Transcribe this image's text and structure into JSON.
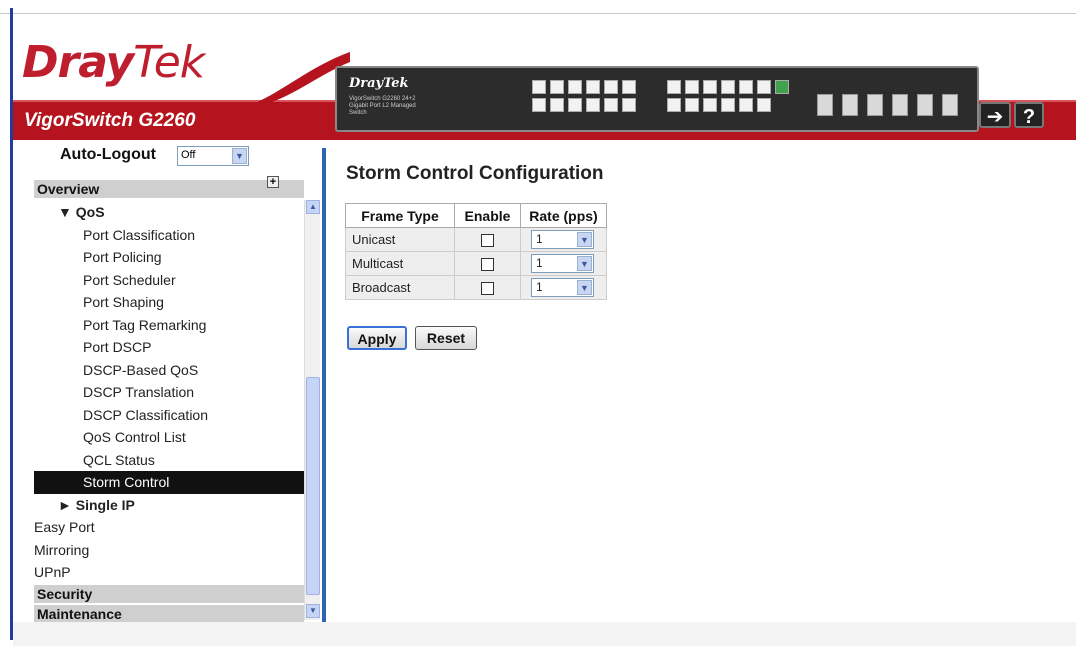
{
  "brand": {
    "logo_dray": "Dray",
    "logo_tek": "Tek",
    "model": "VigorSwitch G2260",
    "device_brand": "DrayTek",
    "device_sub": "VigorSwitch G2260 24+2 Gigabit Port L2 Managed Switch",
    "accent": "#be1e2d",
    "band_color": "#b5141f"
  },
  "header": {
    "logout_icon": "logout-icon",
    "help_label": "?"
  },
  "autologout": {
    "label": "Auto-Logout",
    "value": "Off"
  },
  "sidebar": {
    "section_overview": "Overview",
    "items": [
      {
        "label": "▼ QoS",
        "level": 1
      },
      {
        "label": "Port Classification",
        "level": 2
      },
      {
        "label": "Port Policing",
        "level": 2
      },
      {
        "label": "Port Scheduler",
        "level": 2
      },
      {
        "label": "Port Shaping",
        "level": 2
      },
      {
        "label": "Port Tag Remarking",
        "level": 2
      },
      {
        "label": "Port DSCP",
        "level": 2
      },
      {
        "label": "DSCP-Based QoS",
        "level": 2
      },
      {
        "label": "DSCP Translation",
        "level": 2
      },
      {
        "label": "DSCP Classification",
        "level": 2
      },
      {
        "label": "QoS Control List",
        "level": 2
      },
      {
        "label": "QCL Status",
        "level": 2
      },
      {
        "label": "Storm Control",
        "level": 2,
        "selected": true
      },
      {
        "label": "► Single IP",
        "level": 1
      },
      {
        "label": "Easy Port",
        "level": 0
      },
      {
        "label": "Mirroring",
        "level": 0
      },
      {
        "label": "UPnP",
        "level": 0
      }
    ],
    "section_security": "Security",
    "section_maintenance": "Maintenance"
  },
  "main": {
    "title": "Storm Control Configuration",
    "columns": [
      "Frame Type",
      "Enable",
      "Rate (pps)"
    ],
    "rows": [
      {
        "frame_type": "Unicast",
        "enabled": false,
        "rate": "1"
      },
      {
        "frame_type": "Multicast",
        "enabled": false,
        "rate": "1"
      },
      {
        "frame_type": "Broadcast",
        "enabled": false,
        "rate": "1"
      }
    ],
    "apply_label": "Apply",
    "reset_label": "Reset"
  }
}
